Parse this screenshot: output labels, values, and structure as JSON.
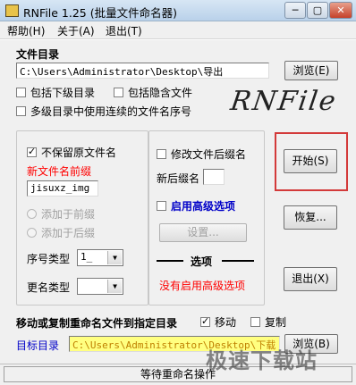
{
  "window": {
    "title": "RNFile 1.25  (批量文件命名器)",
    "minimize_glyph": "─",
    "maximize_glyph": "▢",
    "close_glyph": "✕"
  },
  "menu": [
    "帮助(H)",
    "关于(A)",
    "退出(T)"
  ],
  "file_dir": {
    "heading": "文件目录",
    "path": "C:\\Users\\Administrator\\Desktop\\导出",
    "browse_label": "浏览(E)"
  },
  "options": {
    "include_subdirs": "包括下级目录",
    "include_hidden": "包括隐含文件",
    "multi_dir_sequence": "多级目录中使用连续的文件名序号"
  },
  "logo_text": "RNFile",
  "rename": {
    "keep_original": "不保留原文件名",
    "keep_original_checked": true,
    "prefix_label": "新文件名前缀",
    "prefix_value": "jisuxz_img",
    "add_before": "添加于前缀",
    "add_after": "添加于后缀",
    "seq_type_label": "序号类型",
    "seq_type_value": "1_",
    "rename_type_label": "更名类型",
    "rename_type_value": ""
  },
  "extension": {
    "modify_ext": "修改文件后缀名",
    "new_ext_label": "新后缀名",
    "new_ext_value": "",
    "advanced_label": "启用高级选项",
    "settings_label": "设置...",
    "options_heading": "选项",
    "advanced_status": "没有启用高级选项"
  },
  "actions": {
    "start": "开始(S)",
    "restore": "恢复...",
    "exit": "退出(X)"
  },
  "move_copy": {
    "heading": "移动或复制重命名文件到指定目录",
    "move_label": "移动",
    "move_checked": true,
    "copy_label": "复制",
    "copy_checked": false,
    "target_label": "目标目录",
    "target_path": "C:\\Users\\Administrator\\Desktop\\下载",
    "browse_label": "浏览(B)"
  },
  "status": "等待重命名操作",
  "watermark": "极速下载站",
  "colors": {
    "highlight": "#d33a3a",
    "prefix_label": "#ff0000",
    "advanced": "#0000c8",
    "target_bg": "#ffff80"
  }
}
